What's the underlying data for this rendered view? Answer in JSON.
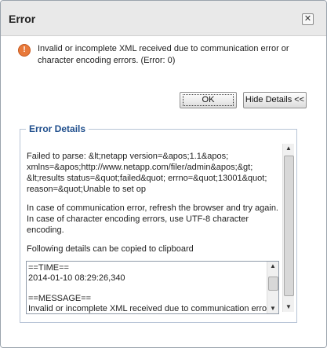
{
  "dialog": {
    "title": "Error",
    "close_glyph": "✕",
    "icon": "warning-icon",
    "message": "Invalid or incomplete XML received due to communication error or character encoding errors. (Error: 0)",
    "ok_label": "OK",
    "hide_details_label": "Hide Details <<"
  },
  "details": {
    "legend": "Error Details",
    "parse_text": "Failed to parse: &lt;netapp version=&apos;1.1&apos; xmlns=&apos;http://www.netapp.com/filer/admin&apos;&gt; &lt;results status=&quot;failed&quot; errno=&quot;13001&quot; reason=&quot;Unable to set op",
    "advice_text": "In case of communication error, refresh the browser and try again. In case of character encoding errors, use UTF-8 character encoding.",
    "clipboard_text": "Following details can be copied to clipboard",
    "log_lines": [
      "==TIME==",
      "2014-01-10 08:29:26,340",
      "",
      "==MESSAGE==",
      "Invalid or incomplete XML received due to communication error"
    ]
  }
}
